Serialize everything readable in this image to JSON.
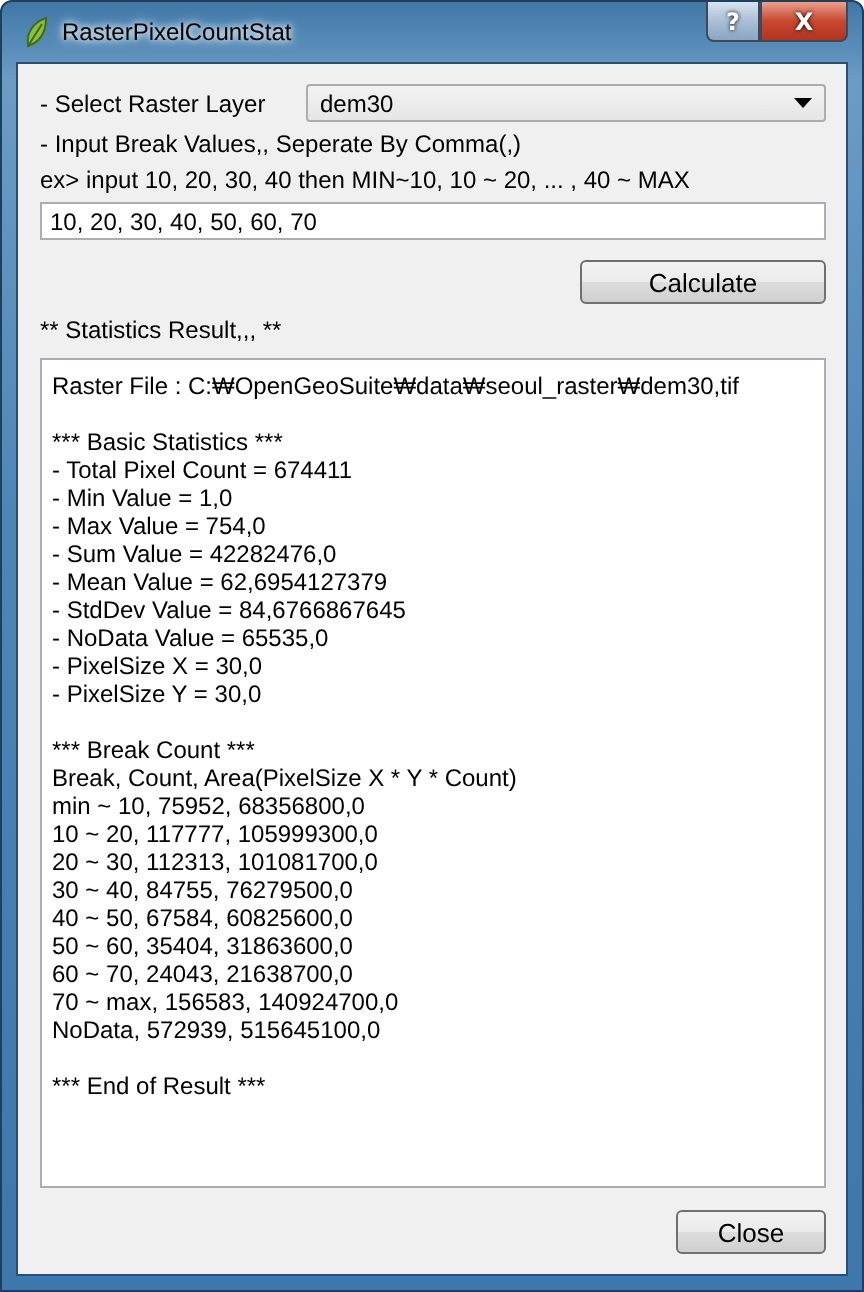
{
  "window": {
    "title": "RasterPixelCountStat",
    "buttons": [
      {
        "kind": "help",
        "label": "?"
      },
      {
        "kind": "close",
        "label": "X"
      }
    ]
  },
  "layer": {
    "label": "- Select Raster Layer",
    "value": "dem30"
  },
  "breaks": {
    "label": "- Input Break Values,, Seperate By Comma(,)",
    "example": "ex> input 10, 20, 30, 40 then MIN~10, 10 ~ 20, ... , 40 ~ MAX",
    "value": "10, 20, 30, 40, 50, 60, 70"
  },
  "calculate_button": "Calculate",
  "result": {
    "label": "** Statistics Result,,, **",
    "sections": [
      [
        "Raster File : C:₩OpenGeoSuite₩data₩seoul_raster₩dem30,tif"
      ],
      [
        "*** Basic Statistics ***",
        "- Total Pixel Count = 674411",
        "- Min Value = 1,0",
        "- Max Value = 754,0",
        "- Sum Value = 42282476,0",
        "- Mean Value = 62,6954127379",
        "- StdDev Value = 84,6766867645",
        "- NoData Value = 65535,0",
        "- PixelSize X = 30,0",
        "- PixelSize Y = 30,0"
      ],
      [
        "*** Break Count ***",
        "Break, Count, Area(PixelSize X * Y * Count)",
        "min ~ 10, 75952, 68356800,0",
        "10 ~ 20, 117777, 105999300,0",
        "20 ~ 30, 112313, 101081700,0",
        "30 ~ 40, 84755, 76279500,0",
        "40 ~ 50, 67584, 60825600,0",
        "50 ~ 60, 35404, 31863600,0",
        "60 ~ 70, 24043, 21638700,0",
        "70 ~ max, 156583, 140924700,0",
        "NoData, 572939, 515645100,0"
      ],
      [
        "*** End of Result ***"
      ]
    ]
  },
  "close_button": "Close"
}
